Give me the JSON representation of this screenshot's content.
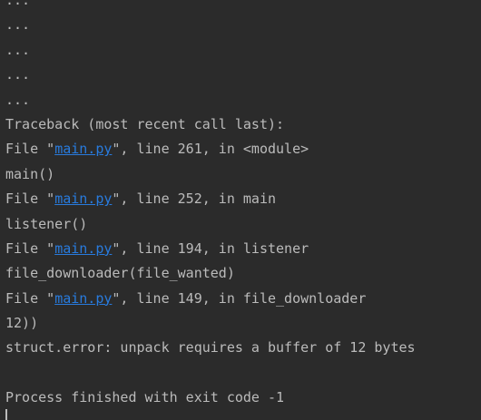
{
  "console": {
    "ellipsis": [
      "...",
      "...",
      "...",
      "...",
      "..."
    ],
    "traceback_header": "Traceback (most recent call last):",
    "frames": [
      {
        "prefix": "File \"",
        "file": "main.py",
        "suffix": "\", line 261, in <module>",
        "code": "main()"
      },
      {
        "prefix": "File \"",
        "file": "main.py",
        "suffix": "\", line 252, in main",
        "code": "listener()"
      },
      {
        "prefix": "File \"",
        "file": "main.py",
        "suffix": "\", line 194, in listener",
        "code": "file_downloader(file_wanted)"
      },
      {
        "prefix": "File \"",
        "file": "main.py",
        "suffix": "\", line 149, in file_downloader",
        "code": "12))"
      }
    ],
    "error": "struct.error: unpack requires a buffer of 12 bytes",
    "exit_message": "Process finished with exit code -1"
  },
  "colors": {
    "background": "#2b2b2b",
    "text": "#bbbbbb",
    "link": "#287bde"
  }
}
